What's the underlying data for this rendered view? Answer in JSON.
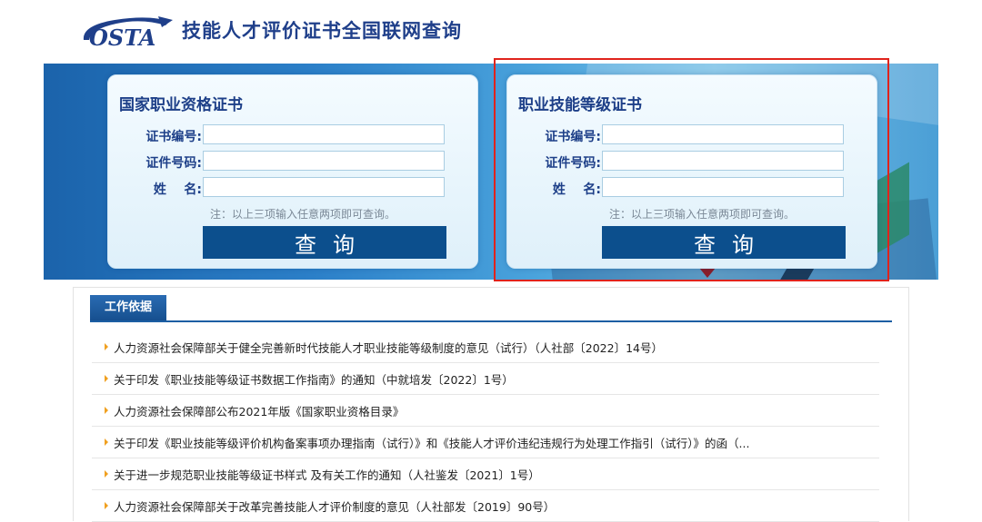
{
  "header": {
    "logo_text": "OSTA",
    "site_title": "技能人才评价证书全国联网查询"
  },
  "cards": {
    "left": {
      "title": "国家职业资格证书",
      "fields": {
        "cert_no_label": "证书编号:",
        "id_no_label": "证件号码:",
        "name_label": "姓    名:"
      },
      "values": {
        "cert_no": "",
        "id_no": "",
        "name": ""
      },
      "note": "注：以上三项输入任意两项即可查询。",
      "button": "查询"
    },
    "right": {
      "title": "职业技能等级证书",
      "fields": {
        "cert_no_label": "证书编号:",
        "id_no_label": "证件号码:",
        "name_label": "姓    名:"
      },
      "values": {
        "cert_no": "",
        "id_no": "",
        "name": ""
      },
      "note": "注：以上三项输入任意两项即可查询。",
      "button": "查询"
    }
  },
  "work_basis": {
    "tab": "工作依据",
    "items": [
      "人力资源社会保障部关于健全完善新时代技能人才职业技能等级制度的意见（试行）（人社部〔2022〕14号）",
      "关于印发《职业技能等级证书数据工作指南》的通知（中就培发〔2022〕1号）",
      "人力资源社会保障部公布2021年版《国家职业资格目录》",
      "关于印发《职业技能等级评价机构备案事项办理指南（试行）》和《技能人才评价违纪违规行为处理工作指引（试行）》的函（...",
      "关于进一步规范职业技能等级证书样式 及有关工作的通知（人社鉴发〔2021〕1号）",
      "人力资源社会保障部关于改革完善技能人才评价制度的意见（人社部发〔2019〕90号）"
    ]
  },
  "colors": {
    "brand": "#1d3f88",
    "button": "#0c4f8d",
    "highlight": "#e0231c",
    "bullet": "#f0a020"
  }
}
